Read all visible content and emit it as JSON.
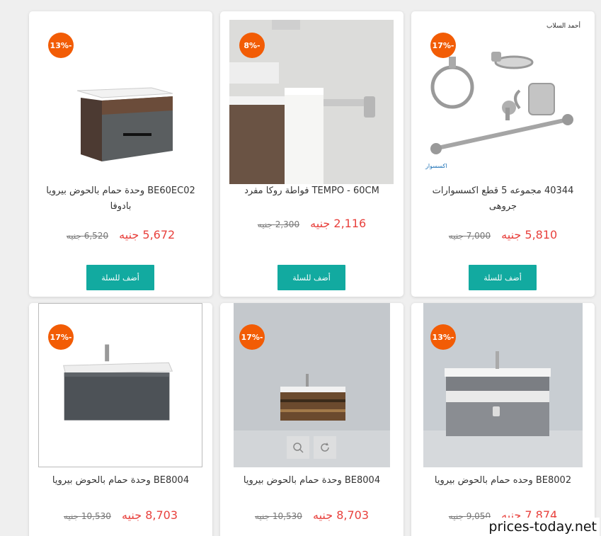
{
  "currency_label": "جنيه",
  "add_to_cart_label": "أضف للسلة",
  "watermark": "prices-today.net",
  "brand_mark": "أحمد السلاب",
  "brand_sub": "اكسسوار",
  "products": [
    {
      "badge": "13%-",
      "title": "BE60EC02 وحدة حمام بالحوض بيرويا بادوفا",
      "price": "5,672",
      "old_price": "6,520",
      "image": "vanity-wood-grey-icon"
    },
    {
      "badge": "8%-",
      "title": "TEMPO - 60CM فواطة روكا مفرد",
      "price": "2,116",
      "old_price": "2,300",
      "image": "towel-bar-icon"
    },
    {
      "badge": "17%-",
      "title": "40344 مجموعه 5 قطع اكسسوارات جروهى",
      "price": "5,810",
      "old_price": "7,000",
      "image": "accessory-set-icon"
    },
    {
      "badge": "17%-",
      "title": "BE8004 وحدة حمام بالحوض بيرويا",
      "price": "8,703",
      "old_price": "10,530",
      "image": "vanity-stone-icon"
    },
    {
      "badge": "17%-",
      "title": "BE8004 وحدة حمام بالحوض بيرويا",
      "price": "8,703",
      "old_price": "10,530",
      "image": "vanity-wood-room-icon"
    },
    {
      "badge": "13%-",
      "title": "BE8002 وحده حمام بالحوض بيرويا",
      "price": "7,874",
      "old_price": "9,050",
      "image": "vanity-grey-room-icon"
    }
  ]
}
